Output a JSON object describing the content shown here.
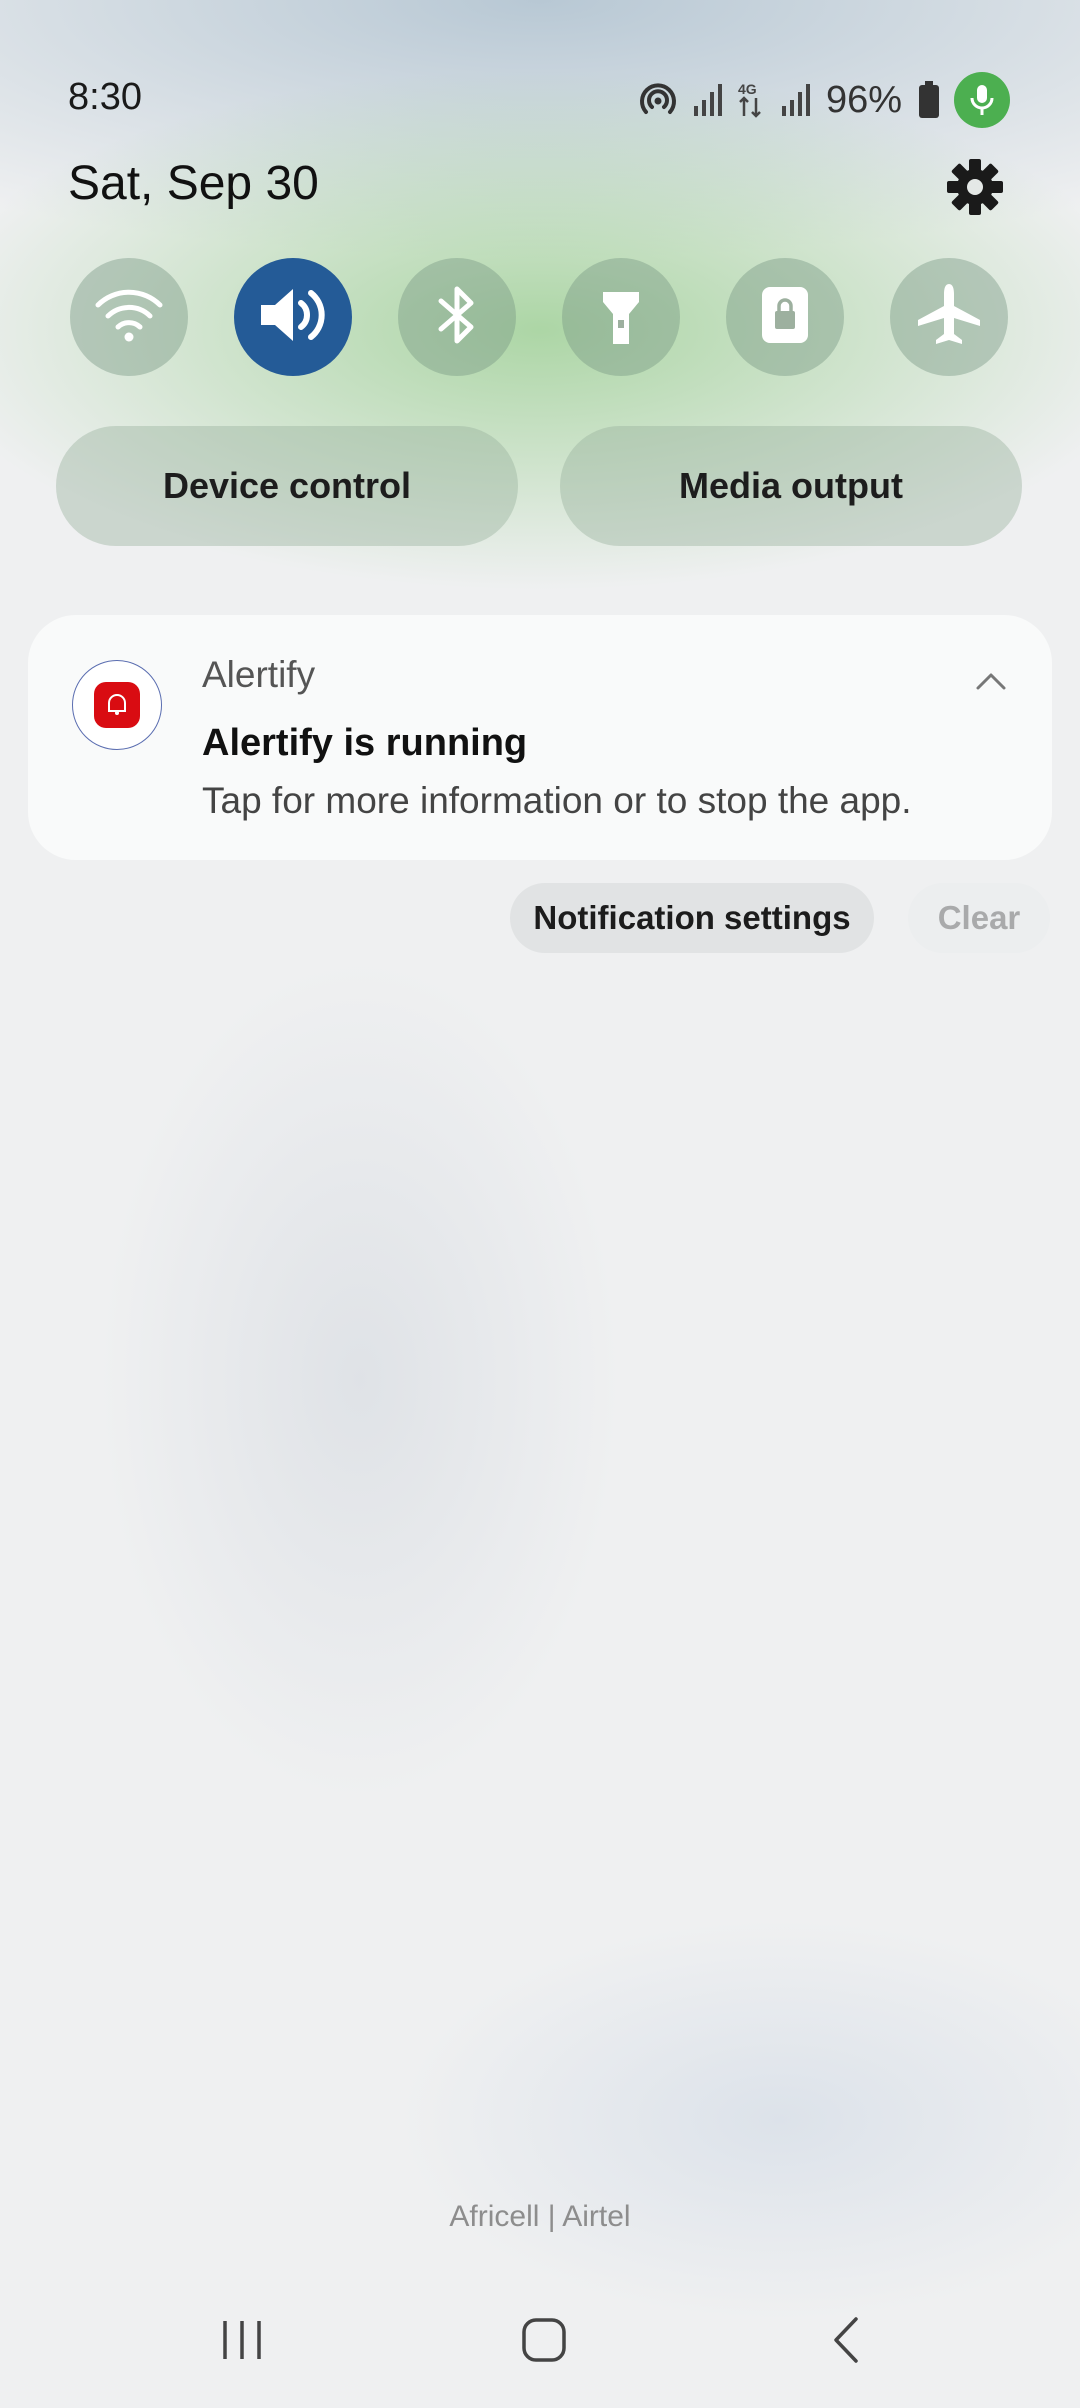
{
  "status_bar": {
    "time": "8:30",
    "battery": "96%",
    "icons": [
      "hotspot-icon",
      "signal-icon",
      "4g-icon",
      "signal-icon",
      "battery-icon",
      "mic-icon"
    ],
    "mic_color": "#4caf50"
  },
  "header": {
    "date": "Sat, Sep 30"
  },
  "quick_tiles": [
    {
      "name": "wifi",
      "icon": "wifi-icon",
      "active": false
    },
    {
      "name": "sound",
      "icon": "speaker-icon",
      "active": true
    },
    {
      "name": "bluetooth",
      "icon": "bluetooth-icon",
      "active": false
    },
    {
      "name": "flashlight",
      "icon": "flashlight-icon",
      "active": false
    },
    {
      "name": "rotation-lock",
      "icon": "lock-icon",
      "active": false
    },
    {
      "name": "airplane-mode",
      "icon": "airplane-icon",
      "active": false
    }
  ],
  "buttons": {
    "device_control": "Device control",
    "media_output": "Media output"
  },
  "notification": {
    "app_name": "Alertify",
    "title": "Alertify is running",
    "body": "Tap for more information or to stop the app.",
    "app_color": "#d90c12"
  },
  "actions": {
    "notification_settings": "Notification settings",
    "clear": "Clear"
  },
  "footer": {
    "carrier": "Africell | Airtel"
  },
  "colors": {
    "active_tile": "#245b97"
  }
}
